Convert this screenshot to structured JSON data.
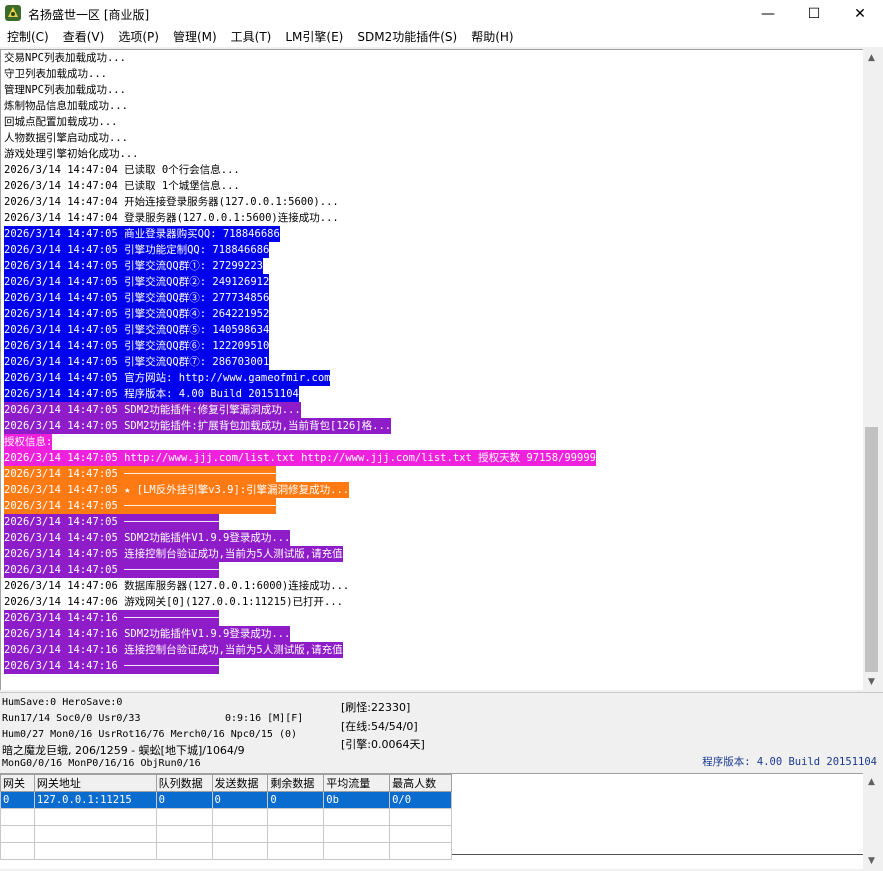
{
  "window": {
    "title": "名扬盛世一区 [商业版]",
    "minimize": "—",
    "maximize": "☐",
    "close": "✕"
  },
  "menu": [
    {
      "label": "控制(C)"
    },
    {
      "label": "查看(V)"
    },
    {
      "label": "选项(P)"
    },
    {
      "label": "管理(M)"
    },
    {
      "label": "工具(T)"
    },
    {
      "label": "LM引擎(E)"
    },
    {
      "label": "SDM2功能插件(S)"
    },
    {
      "label": "帮助(H)"
    }
  ],
  "colors": {
    "blue": "#0000ee",
    "purple": "#8e1cc8",
    "magenta": "#ee22dd",
    "orange": "#ff7a12"
  },
  "log": [
    {
      "text": "交易NPC列表加载成功...",
      "bg": ""
    },
    {
      "text": "守卫列表加载成功...",
      "bg": ""
    },
    {
      "text": "管理NPC列表加载成功...",
      "bg": ""
    },
    {
      "text": "炼制物品信息加载成功...",
      "bg": ""
    },
    {
      "text": "回城点配置加载成功...",
      "bg": ""
    },
    {
      "text": "人物数据引擎启动成功...",
      "bg": ""
    },
    {
      "text": "游戏处理引擎初始化成功...",
      "bg": ""
    },
    {
      "text": "2026/3/14 14:47:04 已读取 0个行会信息...",
      "bg": ""
    },
    {
      "text": "2026/3/14 14:47:04 已读取 1个城堡信息...",
      "bg": ""
    },
    {
      "text": "2026/3/14 14:47:04 开始连接登录服务器(127.0.0.1:5600)...",
      "bg": ""
    },
    {
      "text": "2026/3/14 14:47:04 登录服务器(127.0.0.1:5600)连接成功...",
      "bg": ""
    },
    {
      "text": "2026/3/14 14:47:05 商业登录器购买QQ: 718846686",
      "bg": "blue"
    },
    {
      "text": "2026/3/14 14:47:05 引擎功能定制QQ: 718846686",
      "bg": "blue"
    },
    {
      "text": "2026/3/14 14:47:05 引擎交流QQ群①: 27299223",
      "bg": "blue"
    },
    {
      "text": "2026/3/14 14:47:05 引擎交流QQ群②: 249126912",
      "bg": "blue"
    },
    {
      "text": "2026/3/14 14:47:05 引擎交流QQ群③: 277734856",
      "bg": "blue"
    },
    {
      "text": "2026/3/14 14:47:05 引擎交流QQ群④: 264221952",
      "bg": "blue"
    },
    {
      "text": "2026/3/14 14:47:05 引擎交流QQ群⑤: 140598634",
      "bg": "blue"
    },
    {
      "text": "2026/3/14 14:47:05 引擎交流QQ群⑥: 122209510",
      "bg": "blue"
    },
    {
      "text": "2026/3/14 14:47:05 引擎交流QQ群⑦: 286703001",
      "bg": "blue"
    },
    {
      "text": "2026/3/14 14:47:05 官方网站: http://www.gameofmir.com",
      "bg": "blue"
    },
    {
      "text": "2026/3/14 14:47:05 程序版本: 4.00 Build 20151104",
      "bg": "blue"
    },
    {
      "text": "2026/3/14 14:47:05 SDM2功能插件:修复引擎漏洞成功...",
      "bg": "purple"
    },
    {
      "text": "2026/3/14 14:47:05 SDM2功能插件:扩展背包加载成功,当前背包[126]格...",
      "bg": "purple"
    },
    {
      "text": "授权信息:",
      "bg": "magenta"
    },
    {
      "text": "2026/3/14 14:47:05 http://www.jjj.com/list.txt http://www.jjj.com/list.txt 授权天数 97158/99999",
      "bg": "magenta"
    },
    {
      "text": "2026/3/14 14:47:05 ────────────────────────",
      "bg": "orange"
    },
    {
      "text": "2026/3/14 14:47:05 ★ [LM反外挂引擎v3.9]:引擎漏洞修复成功...",
      "bg": "orange"
    },
    {
      "text": "2026/3/14 14:47:05 ────────────────────────",
      "bg": "orange"
    },
    {
      "text": "2026/3/14 14:47:05 ───────────────",
      "bg": "purple"
    },
    {
      "text": "2026/3/14 14:47:05 SDM2功能插件V1.9.9登录成功...",
      "bg": "purple"
    },
    {
      "text": "2026/3/14 14:47:05 连接控制台验证成功,当前为5人测试版,请充值",
      "bg": "purple"
    },
    {
      "text": "2026/3/14 14:47:05 ───────────────",
      "bg": "purple"
    },
    {
      "text": "2026/3/14 14:47:06 数据库服务器(127.0.0.1:6000)连接成功...",
      "bg": ""
    },
    {
      "text": "2026/3/14 14:47:06 游戏网关[0](127.0.0.1:11215)已打开...",
      "bg": ""
    },
    {
      "text": "2026/3/14 14:47:16 ───────────────",
      "bg": "purple"
    },
    {
      "text": "2026/3/14 14:47:16 SDM2功能插件V1.9.9登录成功...",
      "bg": "purple"
    },
    {
      "text": "2026/3/14 14:47:16 连接控制台验证成功,当前为5人测试版,请充值",
      "bg": "purple"
    },
    {
      "text": "2026/3/14 14:47:16 ───────────────",
      "bg": "purple"
    }
  ],
  "status": {
    "line1": "HumSave:0 HeroSave:0",
    "line2": "Run17/14 Soc0/0 Usr0/33",
    "time": "0:9:16 [M][F]",
    "line3": "Hum0/27 Mon0/16 UsrRot16/76 Merch0/16 Npc0/15 (0)",
    "line4": "暗之魔龙巨蛾, 206/1259 - 蜈蚣[地下城]/1064/9",
    "line5": "MonG0/0/16 MonP0/16/16 ObjRun0/16",
    "refresh": "[刷怪:22330]",
    "online": "[在线:54/54/0]",
    "engine": "[引擎:0.0064天]",
    "version": "程序版本: 4.00 Build 20151104"
  },
  "grid": {
    "headers": [
      "网关",
      "网关地址",
      "队列数据",
      "发送数据",
      "剩余数据",
      "平均流量",
      "最高人数"
    ],
    "rows": [
      [
        "0",
        "127.0.0.1:11215",
        "0",
        "0",
        "0",
        "0b",
        "0/0"
      ]
    ]
  }
}
